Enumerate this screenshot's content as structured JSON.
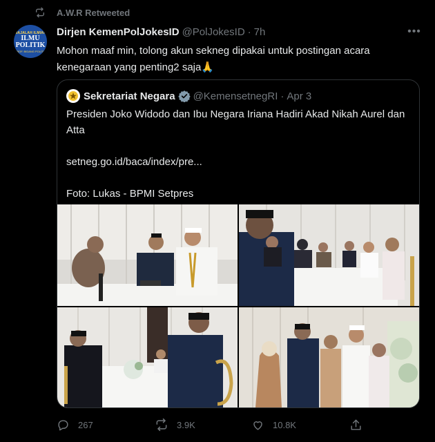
{
  "retweet": {
    "text": "A.W.R Retweeted"
  },
  "tweet": {
    "author_name": "Dirjen KemenPolJokesID",
    "handle": "@PolJokesID",
    "separator": "·",
    "time": "7h",
    "more_label": "•••",
    "text": "Mohon maaf min, tolong akun sekneg dipakai untuk postingan acara kenegaraan yang penting2 saja🙏",
    "avatar": {
      "line1": "MAJALAH ILMIAH",
      "line2a": "ILMU",
      "line2b": "POLITIK",
      "line3": "PROF. BIDANG POLITIK"
    }
  },
  "quote": {
    "author_name": "Sekretariat Negara",
    "handle": "@KemensetnegRI",
    "separator": "·",
    "time": "Apr 3",
    "text_line1": "Presiden Joko Widodo dan Ibu Negara Iriana Hadiri Akad Nikah Aurel dan Atta",
    "text_link": "setneg.go.id/baca/index/pre...",
    "text_photo": "Foto: Lukas - BPMI Setpres"
  },
  "actions": {
    "replies": "267",
    "retweets": "3.9K",
    "likes": "10.8K"
  },
  "colors": {
    "background": "#000000",
    "muted": "#71767b",
    "border": "#2f3336",
    "verified": "#829aab"
  },
  "icons": [
    "retweet-icon",
    "more-icon",
    "verified-icon",
    "reply-icon",
    "like-icon",
    "share-icon",
    "garuda-emblem-icon"
  ]
}
